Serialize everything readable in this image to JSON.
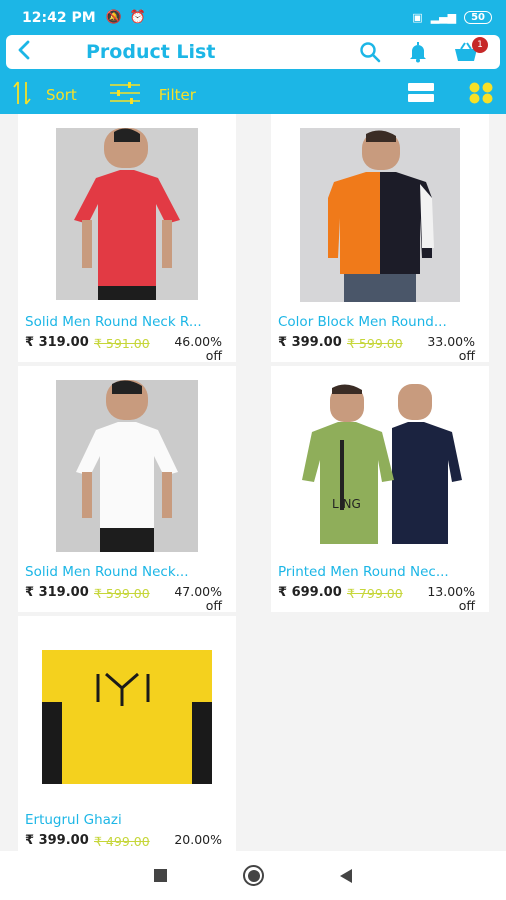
{
  "status": {
    "time": "12:42 PM",
    "battery": "50"
  },
  "header": {
    "title": "Product List",
    "cart_count": "1"
  },
  "toolbar": {
    "sort_label": "Sort",
    "filter_label": "Filter"
  },
  "colors": {
    "primary": "#1cb6e6",
    "accent": "#f7e027",
    "mrp": "#c6d63a",
    "badge": "#c62828"
  },
  "products": [
    {
      "name": "Solid Men Round Neck R...",
      "price": "₹ 319.00",
      "mrp": "₹ 591.00",
      "discount": "46.00%",
      "off": "off",
      "shirt_color": "#e23a44",
      "image": "red-tshirt-model"
    },
    {
      "name": "Color Block Men Round...",
      "price": "₹ 399.00",
      "mrp": "₹ 599.00",
      "discount": "33.00%",
      "off": "off",
      "shirt_color": "#f07a1a",
      "image": "colorblock-tshirt-model"
    },
    {
      "name": "Solid Men Round Neck...",
      "price": "₹ 319.00",
      "mrp": "₹ 599.00",
      "discount": "47.00%",
      "off": "off",
      "shirt_color": "#f8f8f8",
      "image": "white-tshirt-model"
    },
    {
      "name": "Printed Men Round Nec...",
      "price": "₹ 699.00",
      "mrp": "₹ 799.00",
      "discount": "13.00%",
      "off": "off",
      "shirt_color": "#8fae5a",
      "image": "two-tshirts-models"
    },
    {
      "name": "Ertugrul Ghazi",
      "price": "₹ 399.00",
      "mrp": "₹ 499.00",
      "discount": "20.00%",
      "off": "",
      "shirt_color": "#f4d11e",
      "image": "yellow-tshirt-print"
    }
  ]
}
